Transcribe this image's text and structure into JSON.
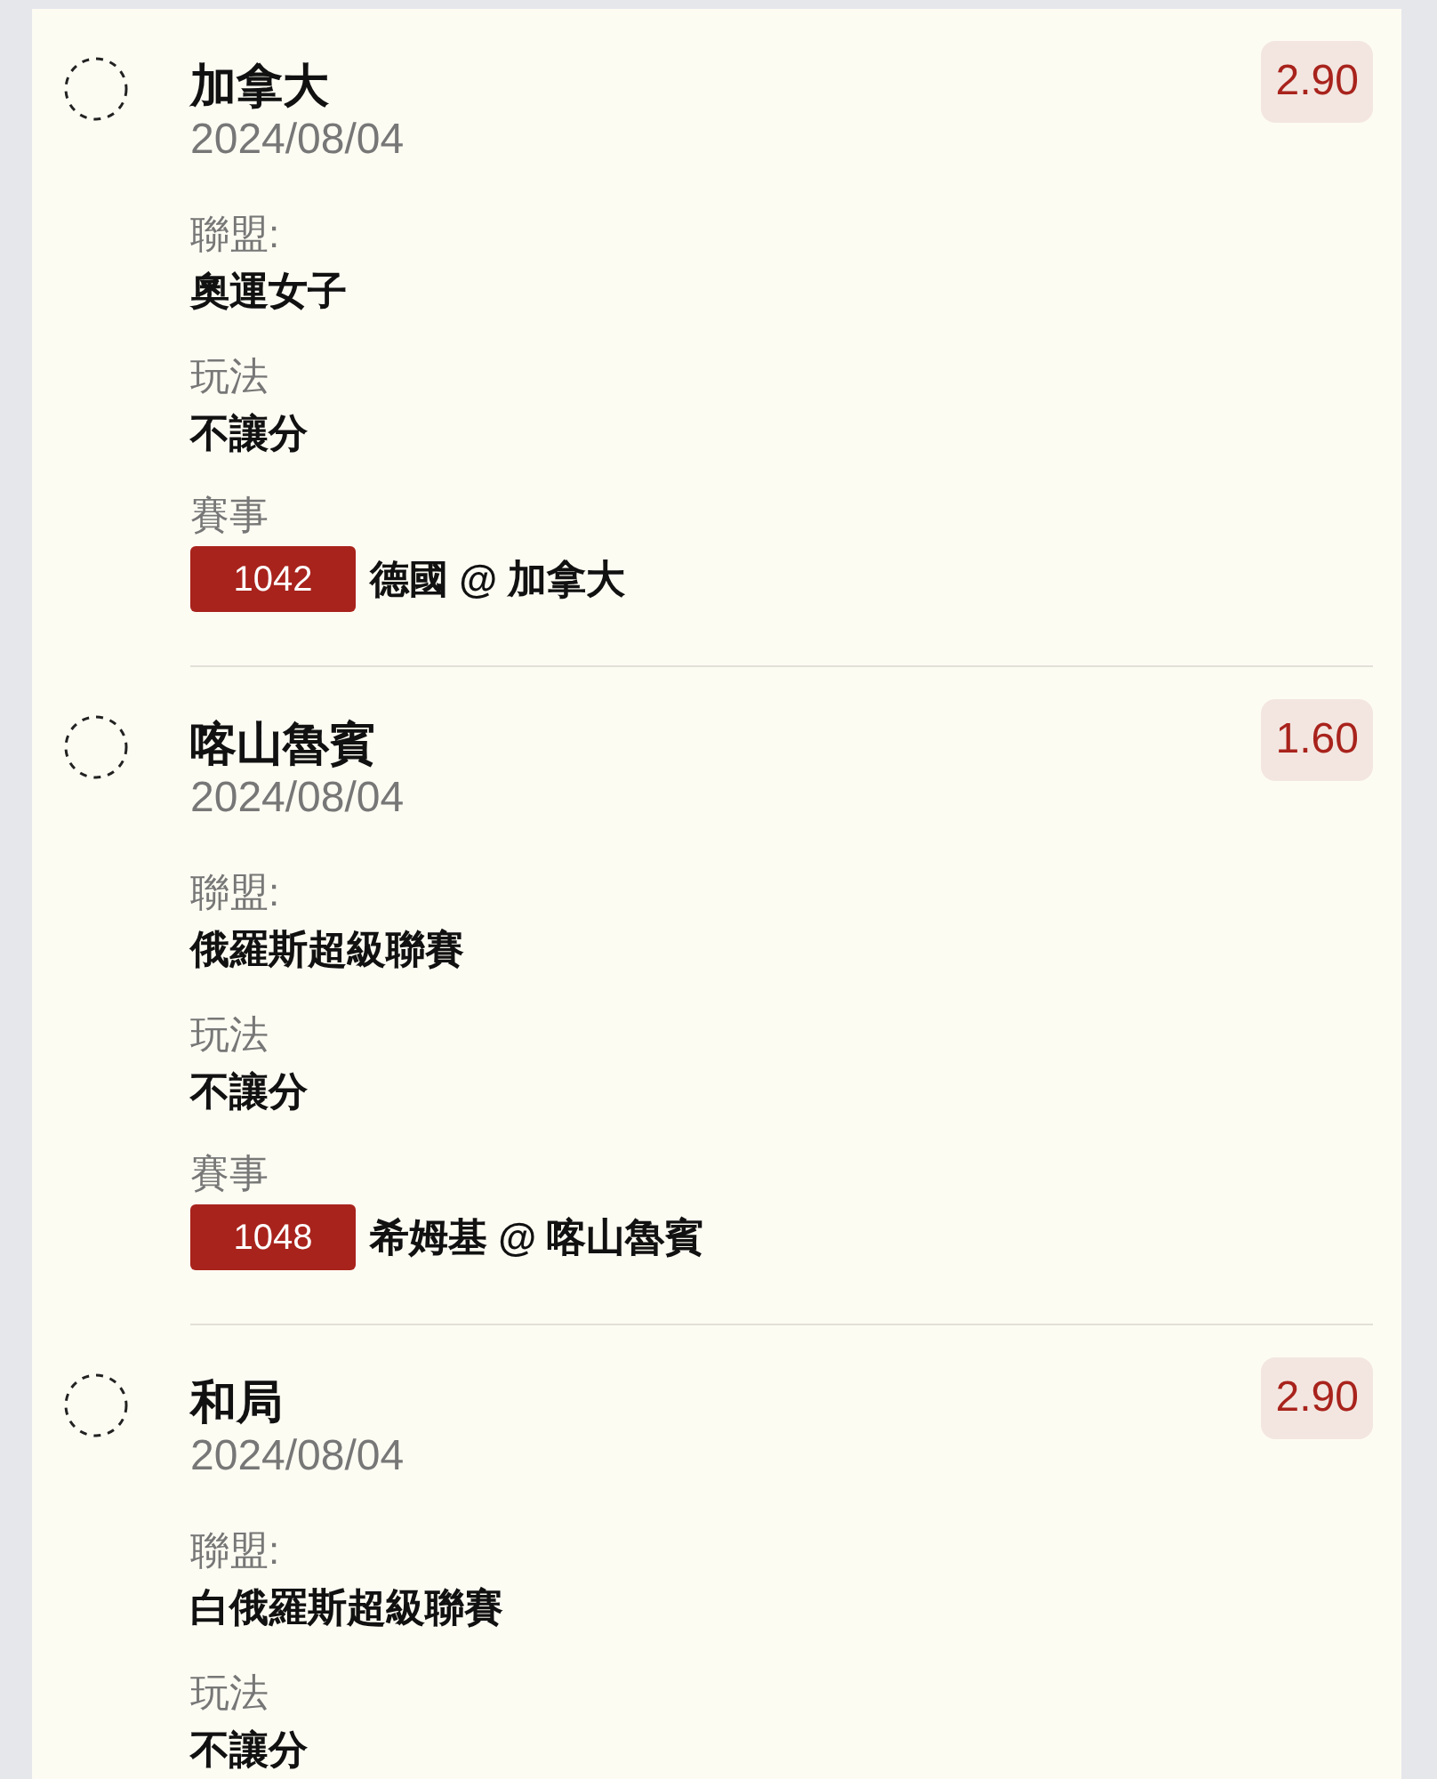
{
  "bets": [
    {
      "selection": "加拿大",
      "date": "2024/08/04",
      "odds": "2.90",
      "selected": false,
      "league_label": "聯盟:",
      "league": "奧運女子",
      "bet_type_label": "玩法",
      "bet_type": "不讓分",
      "match_label": "賽事",
      "match_code": "1042",
      "match": "德國 @ 加拿大"
    },
    {
      "selection": "喀山魯賓",
      "date": "2024/08/04",
      "odds": "1.60",
      "selected": false,
      "league_label": "聯盟:",
      "league": "俄羅斯超級聯賽",
      "bet_type_label": "玩法",
      "bet_type": "不讓分",
      "match_label": "賽事",
      "match_code": "1048",
      "match": "希姆基 @ 喀山魯賓"
    },
    {
      "selection": "和局",
      "date": "2024/08/04",
      "odds": "2.90",
      "selected": false,
      "league_label": "聯盟:",
      "league": "白俄羅斯超級聯賽",
      "bet_type_label": "玩法",
      "bet_type": "不讓分"
    }
  ]
}
